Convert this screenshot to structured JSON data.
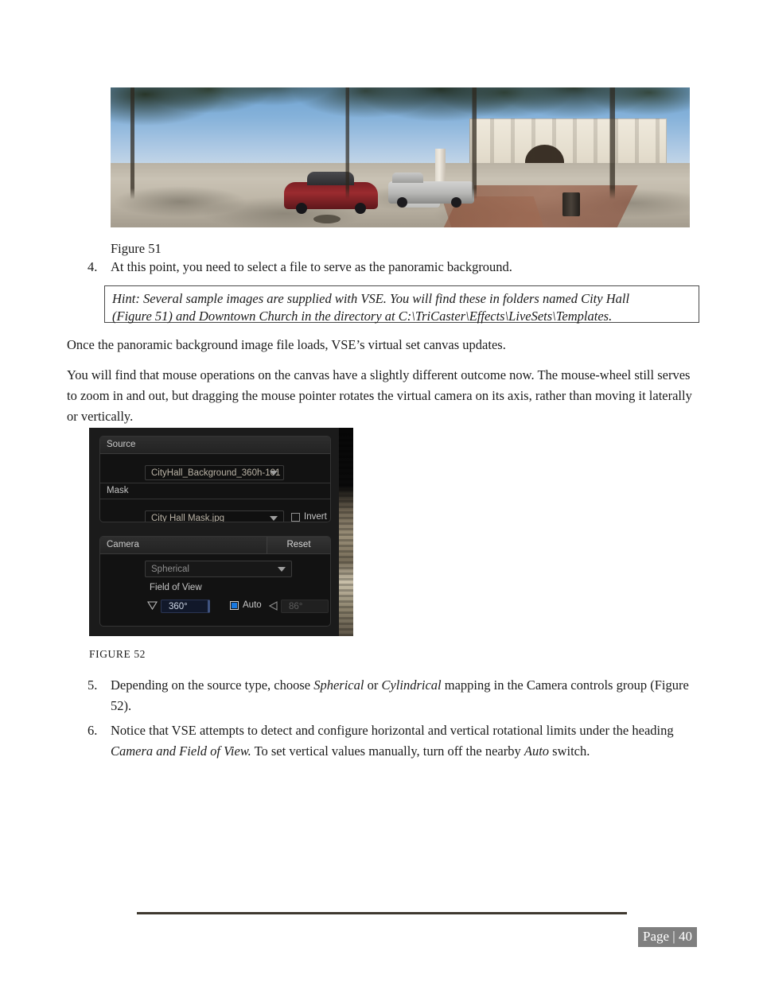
{
  "figure51": {
    "caption": "Figure 51",
    "alt": "Panoramic photograph of a city square with trees, parked cars, a monument obelisk and a stone courthouse building"
  },
  "steps": [
    {
      "number": "4.",
      "text": "At this point, you need to select a file to serve as the panoramic background."
    },
    {
      "number": "5.",
      "text_parts": [
        {
          "t": "Depending on the source type, choose ",
          "i": false
        },
        {
          "t": "Spherical",
          "i": true
        },
        {
          "t": " or ",
          "i": false
        },
        {
          "t": "Cylindrical",
          "i": true
        },
        {
          "t": " mapping in the Camera controls group (Figure 52).",
          "i": false
        }
      ]
    },
    {
      "number": "6.",
      "text_parts": [
        {
          "t": "Notice that VSE attempts to detect and configure horizontal and vertical rotational limits under the heading ",
          "i": false
        },
        {
          "t": "Camera and Field of View.",
          "i": true
        },
        {
          "t": "  To set vertical values manually, turn off the nearby ",
          "i": false
        },
        {
          "t": "Auto",
          "i": true
        },
        {
          "t": " switch.",
          "i": false
        }
      ]
    }
  ],
  "hint": {
    "line1": "Hint: Several sample images are supplied with VSE.  You will find these in folders named City Hall",
    "line2": "(Figure 51) and Downtown Church in the directory at C:\\TriCaster\\Effects\\LiveSets\\Templates."
  },
  "paragraphs": {
    "p1": "Once the panoramic background image file loads, VSE’s virtual set canvas updates.",
    "p2": "You will find that mouse operations on the canvas have a slightly different outcome now.  The mouse-wheel still serves to zoom in and out, but dragging the mouse pointer rotates the virtual camera on its axis, rather than moving it laterally or vertically."
  },
  "figure52": {
    "caption": "FIGURE 52",
    "panel": {
      "source_group": {
        "header": "Source",
        "source_value": "CityHall_Background_360h-101",
        "mask_label": "Mask",
        "mask_value": "City Hall Mask.jpg",
        "invert_label": "Invert",
        "invert_checked": false
      },
      "camera_group": {
        "header": "Camera",
        "reset_label": "Reset",
        "projection_value": "Spherical",
        "fov_label": "Field of View",
        "fov_horizontal": "360°",
        "auto_label": "Auto",
        "auto_checked": true,
        "fov_vertical": "86°"
      }
    },
    "colors": {
      "accent_blue": "#1878e0",
      "panel_bg": "#1b1b1b",
      "group_bg": "#121212",
      "field_text": "#b9b2a5"
    }
  },
  "footer": {
    "page_label": "Page | 40"
  }
}
